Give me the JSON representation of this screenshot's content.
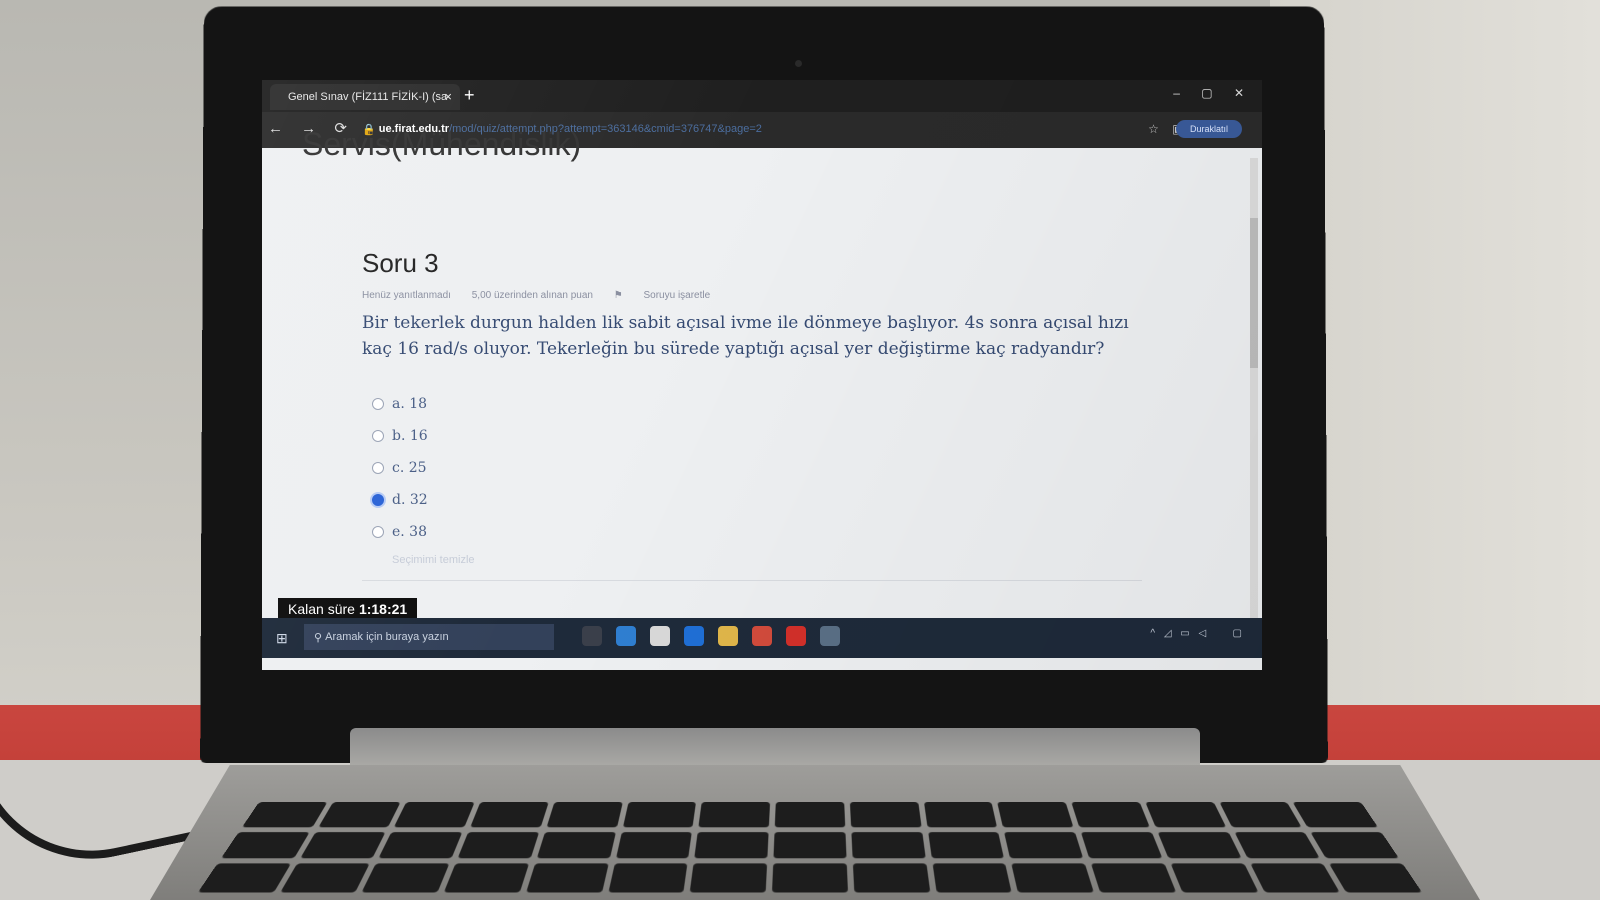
{
  "browser": {
    "tab_title": "Genel Sınav (FİZ111 FİZİK-I) (sa",
    "tab_close": "×",
    "new_tab": "+",
    "url_host": "ue.firat.edu.tr",
    "url_path": "/mod/quiz/attempt.php?attempt=363146&cmid=376747&page=2",
    "profile_label": "Duraklatıl"
  },
  "page": {
    "heading": "Servis(Mühendislik)"
  },
  "question": {
    "title": "Soru 3",
    "status": "Henüz yanıtlanmadı",
    "points": "5,00 üzerinden alınan puan",
    "flag": "Soruyu işaretle",
    "text": "Bir tekerlek durgun halden lik sabit açısal ivme ile dönmeye başlıyor. 4s sonra açısal hızı kaç 16 rad/s oluyor. Tekerleğin bu sürede yaptığı açısal yer değiştirme kaç radyandır?",
    "answers": [
      {
        "label": "a. 18",
        "selected": false
      },
      {
        "label": "b. 16",
        "selected": false
      },
      {
        "label": "c. 25",
        "selected": false
      },
      {
        "label": "d. 32",
        "selected": true
      },
      {
        "label": "e. 38",
        "selected": false
      }
    ],
    "clear_choice": "Seçimimi temizle"
  },
  "timer": {
    "label": "Kalan süre",
    "value": "1:18:21"
  },
  "taskbar": {
    "search_placeholder": "Aramak için buraya yazın"
  }
}
